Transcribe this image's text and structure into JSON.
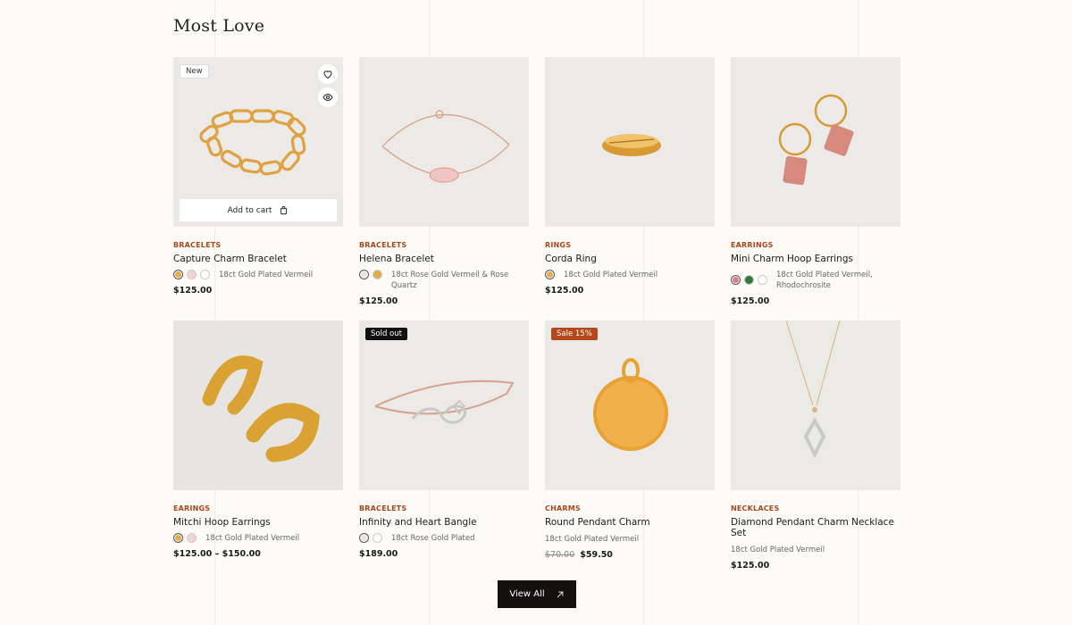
{
  "section": {
    "title": "Most Love",
    "view_all_label": "View All"
  },
  "products": [
    {
      "badge": "New",
      "category": "BRACELETS",
      "name": "Capture Charm Bracelet",
      "swatches": [
        "#e0ad4e",
        "#f1d3d5",
        "#ffffff"
      ],
      "material": "18ct Gold Plated Vermeil",
      "price": "$125.00",
      "add_to_cart": "Add to cart"
    },
    {
      "category": "BRACELETS",
      "name": "Helena Bracelet",
      "swatches": [
        "#f6dfe2",
        "#e0ad4e"
      ],
      "material": "18ct Rose Gold Vermeil & Rose Quartz",
      "price": "$125.00"
    },
    {
      "category": "RINGS",
      "name": "Corda Ring",
      "swatches": [
        "#e0ad4e"
      ],
      "material": "18ct Gold Plated Vermeil",
      "price": "$125.00"
    },
    {
      "category": "EARRINGS",
      "name": "Mini Charm Hoop Earrings",
      "swatches": [
        "#d97f86",
        "#2f7a3c",
        "#ffffff"
      ],
      "material_line1": "18ct Gold Plated Vermeil,",
      "material_line2": "Rhodochrosite",
      "price": "$125.00"
    },
    {
      "category": "EARINGS",
      "name": "Mitchi Hoop Earrings",
      "swatches": [
        "#e0ad4e",
        "#f1d3d5"
      ],
      "material": "18ct Gold Plated Vermeil",
      "price": "$125.00 – $150.00"
    },
    {
      "badge": "Sold out",
      "category": "BRACELETS",
      "name": "Infinity and Heart Bangle",
      "swatches": [
        "#f6dfe2",
        "#ffffff"
      ],
      "material": "18ct Rose Gold Plated",
      "price": "$189.00"
    },
    {
      "badge": "Sale 15%",
      "category": "CHARMS",
      "name": "Round Pendant Charm",
      "material": "18ct Gold Plated Vermeil",
      "old_price": "$70.00",
      "price": "$59.50"
    },
    {
      "category": "NECKLACES",
      "name": "Diamond Pendant Charm Necklace Set",
      "material": "18ct Gold Plated Vermeil",
      "price": "$125.00"
    }
  ],
  "icons": {
    "wishlist": "heart-icon",
    "quick_view": "eye-icon",
    "cart": "shopping-bag-icon",
    "arrow": "arrow-up-right-icon"
  },
  "colors": {
    "category": "#a8461a",
    "sale_badge": "#b5481b",
    "sold_badge": "#111111",
    "button": "#131110",
    "card_bg": "#ebeae7"
  }
}
